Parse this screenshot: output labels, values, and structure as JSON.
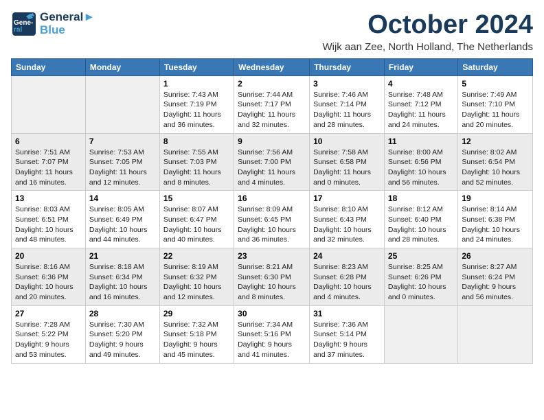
{
  "header": {
    "logo_line1": "General",
    "logo_line2": "Blue",
    "month": "October 2024",
    "location": "Wijk aan Zee, North Holland, The Netherlands"
  },
  "weekdays": [
    "Sunday",
    "Monday",
    "Tuesday",
    "Wednesday",
    "Thursday",
    "Friday",
    "Saturday"
  ],
  "weeks": [
    [
      {
        "day": "",
        "info": ""
      },
      {
        "day": "",
        "info": ""
      },
      {
        "day": "1",
        "info": "Sunrise: 7:43 AM\nSunset: 7:19 PM\nDaylight: 11 hours and 36 minutes."
      },
      {
        "day": "2",
        "info": "Sunrise: 7:44 AM\nSunset: 7:17 PM\nDaylight: 11 hours and 32 minutes."
      },
      {
        "day": "3",
        "info": "Sunrise: 7:46 AM\nSunset: 7:14 PM\nDaylight: 11 hours and 28 minutes."
      },
      {
        "day": "4",
        "info": "Sunrise: 7:48 AM\nSunset: 7:12 PM\nDaylight: 11 hours and 24 minutes."
      },
      {
        "day": "5",
        "info": "Sunrise: 7:49 AM\nSunset: 7:10 PM\nDaylight: 11 hours and 20 minutes."
      }
    ],
    [
      {
        "day": "6",
        "info": "Sunrise: 7:51 AM\nSunset: 7:07 PM\nDaylight: 11 hours and 16 minutes."
      },
      {
        "day": "7",
        "info": "Sunrise: 7:53 AM\nSunset: 7:05 PM\nDaylight: 11 hours and 12 minutes."
      },
      {
        "day": "8",
        "info": "Sunrise: 7:55 AM\nSunset: 7:03 PM\nDaylight: 11 hours and 8 minutes."
      },
      {
        "day": "9",
        "info": "Sunrise: 7:56 AM\nSunset: 7:00 PM\nDaylight: 11 hours and 4 minutes."
      },
      {
        "day": "10",
        "info": "Sunrise: 7:58 AM\nSunset: 6:58 PM\nDaylight: 11 hours and 0 minutes."
      },
      {
        "day": "11",
        "info": "Sunrise: 8:00 AM\nSunset: 6:56 PM\nDaylight: 10 hours and 56 minutes."
      },
      {
        "day": "12",
        "info": "Sunrise: 8:02 AM\nSunset: 6:54 PM\nDaylight: 10 hours and 52 minutes."
      }
    ],
    [
      {
        "day": "13",
        "info": "Sunrise: 8:03 AM\nSunset: 6:51 PM\nDaylight: 10 hours and 48 minutes."
      },
      {
        "day": "14",
        "info": "Sunrise: 8:05 AM\nSunset: 6:49 PM\nDaylight: 10 hours and 44 minutes."
      },
      {
        "day": "15",
        "info": "Sunrise: 8:07 AM\nSunset: 6:47 PM\nDaylight: 10 hours and 40 minutes."
      },
      {
        "day": "16",
        "info": "Sunrise: 8:09 AM\nSunset: 6:45 PM\nDaylight: 10 hours and 36 minutes."
      },
      {
        "day": "17",
        "info": "Sunrise: 8:10 AM\nSunset: 6:43 PM\nDaylight: 10 hours and 32 minutes."
      },
      {
        "day": "18",
        "info": "Sunrise: 8:12 AM\nSunset: 6:40 PM\nDaylight: 10 hours and 28 minutes."
      },
      {
        "day": "19",
        "info": "Sunrise: 8:14 AM\nSunset: 6:38 PM\nDaylight: 10 hours and 24 minutes."
      }
    ],
    [
      {
        "day": "20",
        "info": "Sunrise: 8:16 AM\nSunset: 6:36 PM\nDaylight: 10 hours and 20 minutes."
      },
      {
        "day": "21",
        "info": "Sunrise: 8:18 AM\nSunset: 6:34 PM\nDaylight: 10 hours and 16 minutes."
      },
      {
        "day": "22",
        "info": "Sunrise: 8:19 AM\nSunset: 6:32 PM\nDaylight: 10 hours and 12 minutes."
      },
      {
        "day": "23",
        "info": "Sunrise: 8:21 AM\nSunset: 6:30 PM\nDaylight: 10 hours and 8 minutes."
      },
      {
        "day": "24",
        "info": "Sunrise: 8:23 AM\nSunset: 6:28 PM\nDaylight: 10 hours and 4 minutes."
      },
      {
        "day": "25",
        "info": "Sunrise: 8:25 AM\nSunset: 6:26 PM\nDaylight: 10 hours and 0 minutes."
      },
      {
        "day": "26",
        "info": "Sunrise: 8:27 AM\nSunset: 6:24 PM\nDaylight: 9 hours and 56 minutes."
      }
    ],
    [
      {
        "day": "27",
        "info": "Sunrise: 7:28 AM\nSunset: 5:22 PM\nDaylight: 9 hours and 53 minutes."
      },
      {
        "day": "28",
        "info": "Sunrise: 7:30 AM\nSunset: 5:20 PM\nDaylight: 9 hours and 49 minutes."
      },
      {
        "day": "29",
        "info": "Sunrise: 7:32 AM\nSunset: 5:18 PM\nDaylight: 9 hours and 45 minutes."
      },
      {
        "day": "30",
        "info": "Sunrise: 7:34 AM\nSunset: 5:16 PM\nDaylight: 9 hours and 41 minutes."
      },
      {
        "day": "31",
        "info": "Sunrise: 7:36 AM\nSunset: 5:14 PM\nDaylight: 9 hours and 37 minutes."
      },
      {
        "day": "",
        "info": ""
      },
      {
        "day": "",
        "info": ""
      }
    ]
  ]
}
